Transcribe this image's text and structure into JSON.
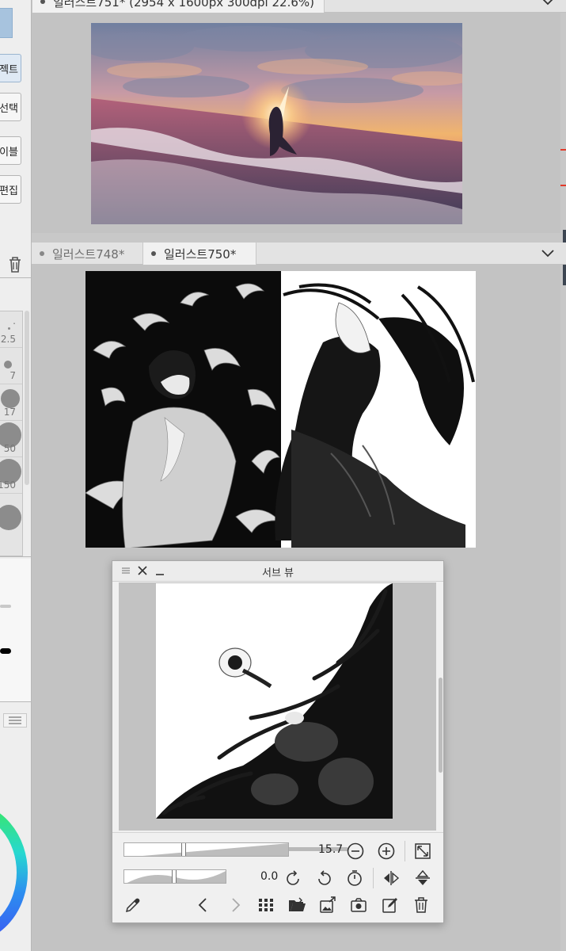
{
  "left_panel": {
    "tool_buttons": [
      {
        "label": "젝트",
        "active": true
      },
      {
        "label": "선택",
        "active": false
      },
      {
        "label": "이블",
        "active": false
      },
      {
        "label": "편집",
        "active": false
      }
    ],
    "brush_sizes": [
      ".",
      "2.5",
      "7",
      "17",
      "50",
      "150",
      ""
    ]
  },
  "top_canvas": {
    "tab_title": "일러스트751* (2954 x 1600px 300dpi 22.6%)"
  },
  "second_canvas": {
    "tabs": [
      {
        "label": "일러스트748*",
        "active": false
      },
      {
        "label": "일러스트750*",
        "active": true
      }
    ]
  },
  "sub_view": {
    "title": "서브 뷰",
    "zoom_value": "15.7",
    "rotation_value": "0.0"
  },
  "icons": {
    "menu": "hamburger-icon",
    "close": "close-icon",
    "minimize": "minimize-icon",
    "zoom_out": "zoom-out-icon",
    "zoom_in": "zoom-in-icon",
    "fit": "fit-to-window-icon",
    "rotate_left": "rotate-left-icon",
    "rotate_right": "rotate-right-icon",
    "reset_rotation": "reset-rotation-icon",
    "flip_h": "flip-horizontal-icon",
    "flip_v": "flip-vertical-icon",
    "eyedropper": "eyedropper-icon",
    "prev": "previous-icon",
    "next": "next-icon",
    "grid": "grid-icon",
    "open": "open-folder-icon",
    "import": "import-image-icon",
    "capture": "camera-icon",
    "edit": "edit-icon",
    "trash": "trash-icon"
  },
  "colors": {
    "accent_selected": "#a7c3de",
    "panel_bg": "#f0f0f0",
    "canvas_bg": "#c3c3c3"
  }
}
